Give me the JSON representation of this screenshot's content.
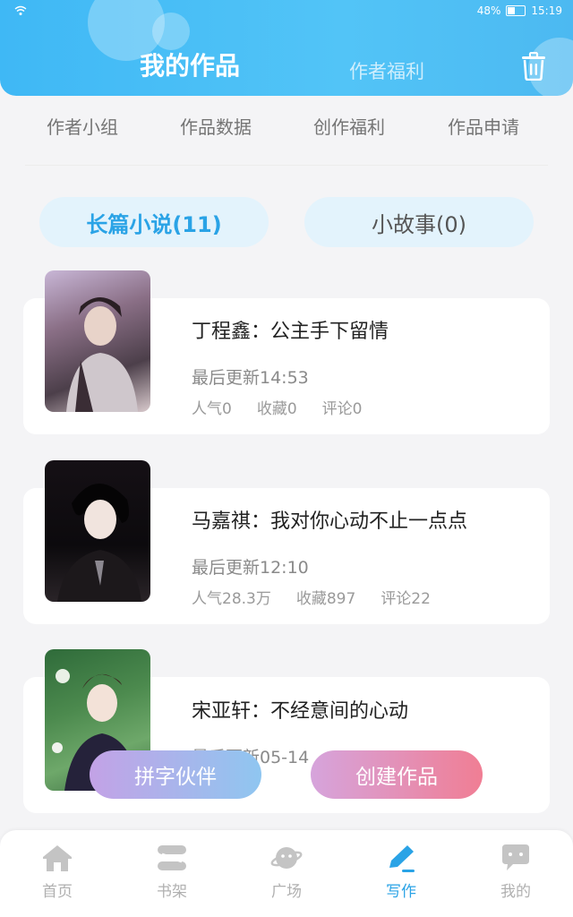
{
  "status": {
    "battery": "48%",
    "time": "15:19"
  },
  "header": {
    "title": "我的作品",
    "subtitle": "作者福利"
  },
  "top_tabs": [
    {
      "label": "作者小组"
    },
    {
      "label": "作品数据"
    },
    {
      "label": "创作福利"
    },
    {
      "label": "作品申请"
    }
  ],
  "category_tabs": [
    {
      "label": "长篇小说(11)",
      "active": true
    },
    {
      "label": "小故事(0)",
      "active": false
    }
  ],
  "works": [
    {
      "title": "丁程鑫：公主手下留情",
      "updated": "最后更新14:53",
      "popularity": "人气0",
      "favorites": "收藏0",
      "comments": "评论0"
    },
    {
      "title": "马嘉祺：我对你心动不止一点点",
      "updated": "最后更新12:10",
      "popularity": "人气28.3万",
      "favorites": "收藏897",
      "comments": "评论22"
    },
    {
      "title": "宋亚轩：不经意间的心动",
      "updated": "最后更新05-14",
      "popularity": "",
      "favorites": "",
      "comments": ""
    }
  ],
  "fab": {
    "partner": "拼字伙伴",
    "create": "创建作品"
  },
  "nav": [
    {
      "label": "首页",
      "icon": "home-icon"
    },
    {
      "label": "书架",
      "icon": "bookshelf-icon"
    },
    {
      "label": "广场",
      "icon": "planet-icon"
    },
    {
      "label": "写作",
      "icon": "pen-icon",
      "active": true
    },
    {
      "label": "我的",
      "icon": "chat-bubble-icon"
    }
  ],
  "colors": {
    "accent": "#2aa3e6",
    "header": "#4bbdf6",
    "inactive": "#b0b0b0"
  }
}
